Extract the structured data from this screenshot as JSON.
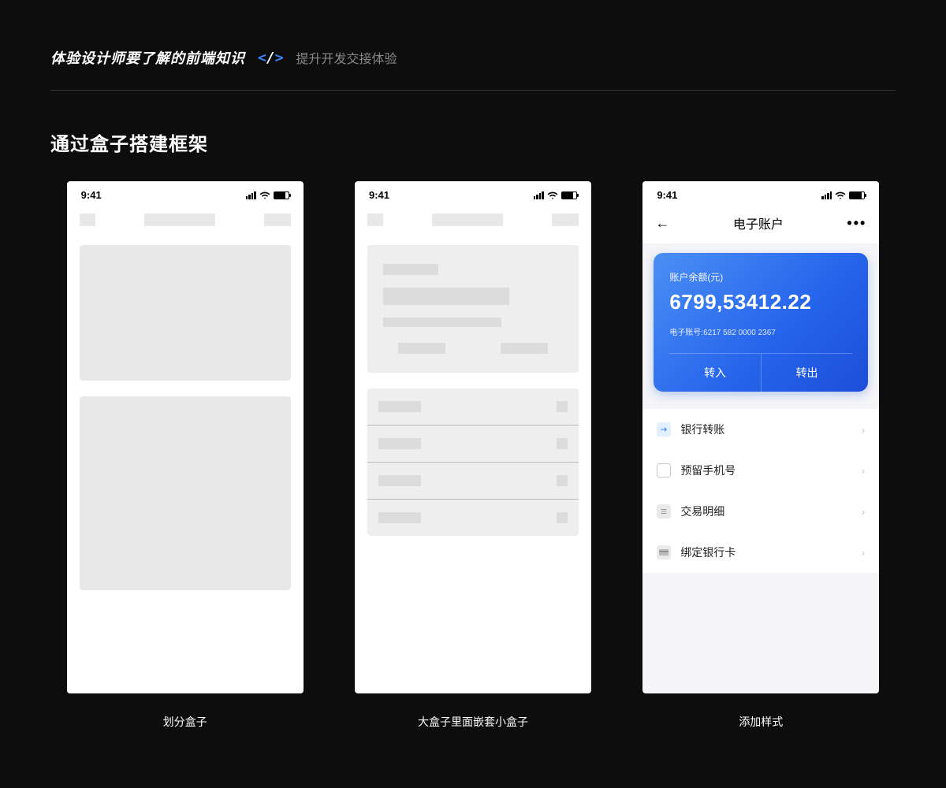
{
  "header": {
    "title": "体验设计师要了解的前端知识",
    "subtitle": "提升开发交接体验"
  },
  "section_title": "通过盒子搭建框架",
  "status_time": "9:41",
  "phone3": {
    "nav_title": "电子账户",
    "balance_label": "账户余额(元)",
    "balance_amount": "6799,53412.22",
    "account_prefix": "电子账号:",
    "account_number": "6217 582 0000 2367",
    "btn_in": "转入",
    "btn_out": "转出",
    "menu": [
      {
        "label": "银行转账"
      },
      {
        "label": "预留手机号"
      },
      {
        "label": "交易明细"
      },
      {
        "label": "绑定银行卡"
      }
    ]
  },
  "captions": [
    "划分盒子",
    "大盒子里面嵌套小盒子",
    "添加样式"
  ]
}
